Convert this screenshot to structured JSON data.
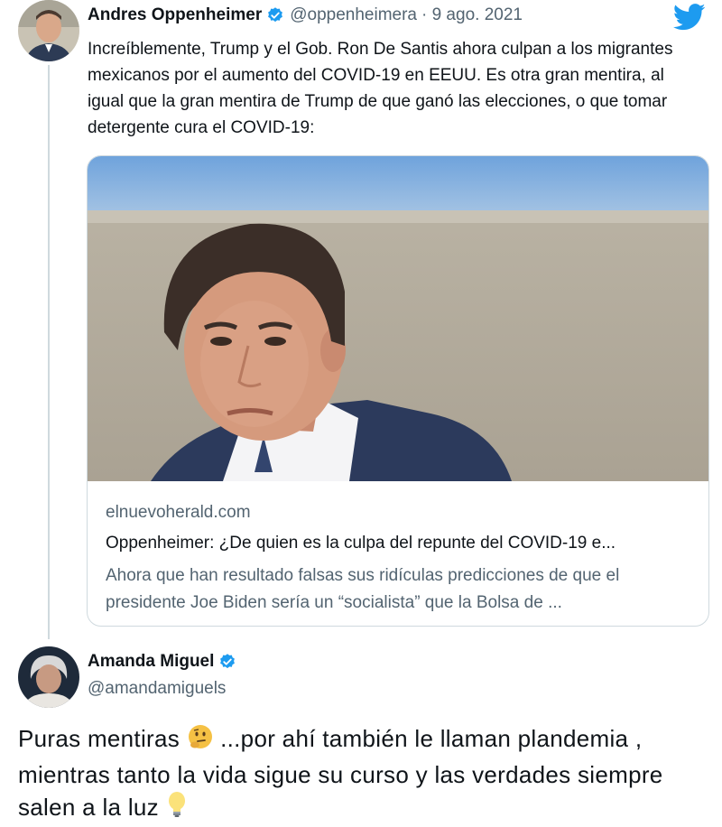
{
  "tweet": {
    "author_name": "Andres Oppenheimer",
    "handle": "@oppenheimera",
    "date": "· 9 ago. 2021",
    "text": "Increíblemente, Trump y el Gob. Ron De Santis ahora culpan a los migrantes mexicanos por el aumento del COVID-19 en EEUU. Es otra gran mentira, al igual que la gran mentira de Trump de que ganó las elecciones, o que tomar detergente cura el COVID-19:",
    "card": {
      "domain": "elnuevoherald.com",
      "title": "Oppenheimer: ¿De quien es la culpa del repunte del COVID-19 e...",
      "description": "Ahora que han resultado falsas sus ridículas predicciones de que el presidente Joe Biden sería un “socialista” que la Bolsa de ..."
    }
  },
  "reply": {
    "author_name": "Amanda Miguel",
    "handle": "@amandamiguels",
    "text_part1": "Puras mentiras",
    "text_part2": "...por ahí también le llaman plandemia , mientras tanto la vida sigue su curso y las verdades siempre salen a la luz",
    "emoji1": "thinking-face-emoji",
    "emoji2": "light-bulb-emoji"
  },
  "colors": {
    "twitter_blue": "#1d9bf0",
    "muted_text": "#536471",
    "border": "#cfd9de"
  },
  "icons": {
    "bird": "twitter-bird-icon",
    "verified": "verified-badge-icon"
  }
}
